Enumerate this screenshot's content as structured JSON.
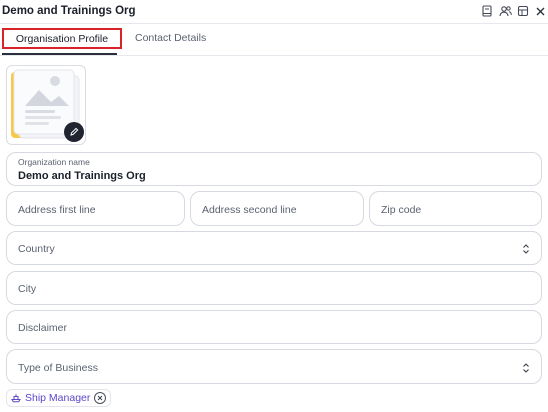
{
  "header": {
    "title": "Demo and Trainings Org"
  },
  "tabs": [
    {
      "label": "Organisation Profile"
    },
    {
      "label": "Contact Details"
    }
  ],
  "form": {
    "org_name_label": "Organization name",
    "org_name_value": "Demo and Trainings Org",
    "address1_placeholder": "Address first line",
    "address2_placeholder": "Address second line",
    "zip_placeholder": "Zip code",
    "country_placeholder": "Country",
    "city_placeholder": "City",
    "disclaimer_placeholder": "Disclaimer",
    "business_type_placeholder": "Type of Business"
  },
  "chips": [
    {
      "label": "Ship Manager"
    }
  ],
  "colors": {
    "accent": "#5a47c9",
    "highlight_border": "#d8232a",
    "dark": "#1f2430"
  }
}
